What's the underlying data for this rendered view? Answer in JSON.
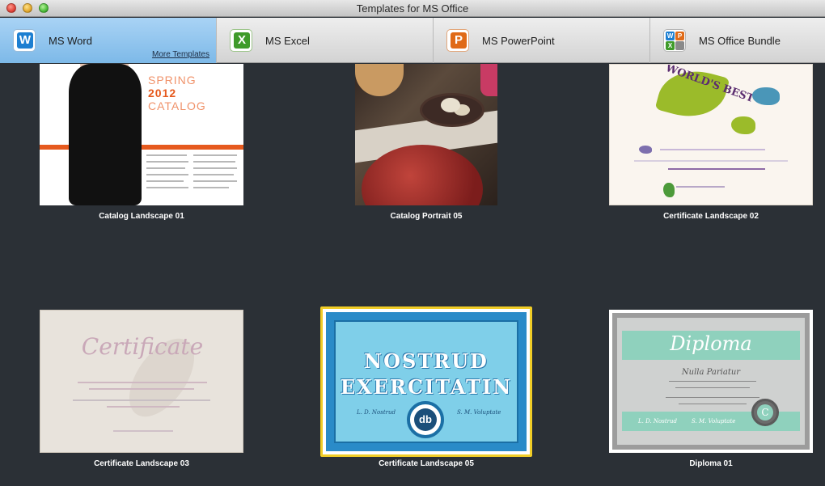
{
  "window": {
    "title": "Templates for MS Office"
  },
  "tabs": [
    {
      "label": "MS Word",
      "icon": "word-icon",
      "glyph": "W",
      "active": true
    },
    {
      "label": "MS Excel",
      "icon": "excel-icon",
      "glyph": "X"
    },
    {
      "label": "MS PowerPoint",
      "icon": "powerpoint-icon",
      "glyph": "P"
    },
    {
      "label": "MS Office Bundle",
      "icon": "office-bundle-icon"
    }
  ],
  "more_templates": "More Templates",
  "templates": [
    {
      "name": "Catalog Landscape 01",
      "preview": {
        "spring": "SPRING",
        "year": "2012",
        "catalog": "CATALOG"
      }
    },
    {
      "name": "Catalog Portrait 05"
    },
    {
      "name": "Certificate Landscape 02",
      "preview": {
        "heading": "WORLD'S BEST"
      }
    },
    {
      "name": "Certificate Landscape 03",
      "preview": {
        "heading": "Certificate"
      }
    },
    {
      "name": "Certificate Landscape 05",
      "selected": true,
      "preview": {
        "line1": "NOSTRUD",
        "line2": "EXERCITATIN",
        "sig_left": "L. D. Nostrud",
        "sig_right": "S. M. Voluptate",
        "badge": "db"
      }
    },
    {
      "name": "Diploma 01",
      "preview": {
        "heading": "Diploma",
        "name": "Nulla Pariatur",
        "sig_left": "L. D. Nostrud",
        "sig_right": "S. M. Voluptate",
        "seal": "C"
      }
    }
  ],
  "colors": {
    "background": "#2b3036",
    "active_tab": "#8cc4ee",
    "selection": "#f1cd27",
    "accent_orange": "#e65a1e"
  }
}
